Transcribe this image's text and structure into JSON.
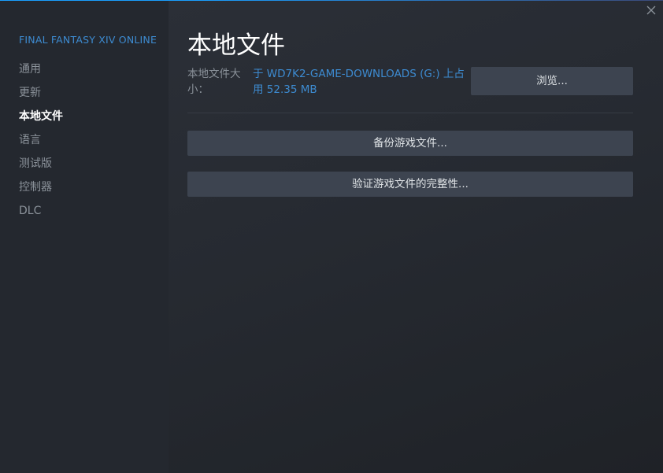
{
  "sidebar": {
    "game_title": "FINAL FANTASY XIV ONLINE",
    "items": [
      {
        "label": "通用",
        "active": false
      },
      {
        "label": "更新",
        "active": false
      },
      {
        "label": "本地文件",
        "active": true
      },
      {
        "label": "语言",
        "active": false
      },
      {
        "label": "测试版",
        "active": false
      },
      {
        "label": "控制器",
        "active": false
      },
      {
        "label": "DLC",
        "active": false
      }
    ]
  },
  "main": {
    "title": "本地文件",
    "size_label": "本地文件大小：",
    "size_value": "于 WD7K2-GAME-DOWNLOADS (G:) 上占用 52.35 MB",
    "browse_button": "浏览...",
    "backup_button": "备份游戏文件...",
    "verify_button": "验证游戏文件的完整性..."
  },
  "window": {
    "close_icon": "close-icon"
  },
  "colors": {
    "accent": "#3d8bd1",
    "background": "#23262d",
    "button": "#3d4450",
    "active_text": "#ffffff",
    "muted_text": "#8b929a"
  }
}
